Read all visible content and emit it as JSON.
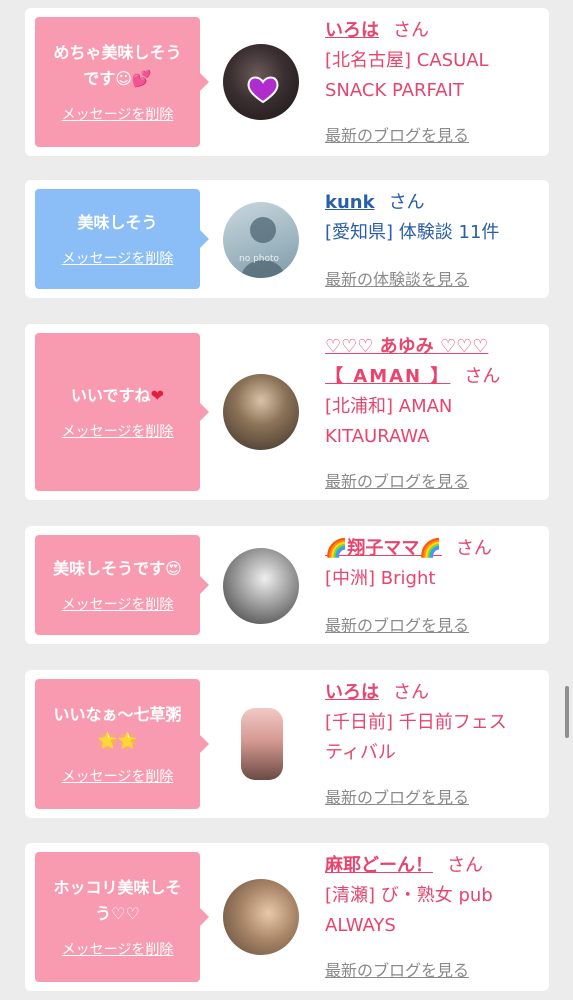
{
  "colors": {
    "background": "#ececec",
    "bubble_pink": "#f99bb0",
    "bubble_blue": "#8bbdf7",
    "name_pink": "#e8456e",
    "name_blue": "#2a5ea8",
    "link_gray": "#8a8a8a"
  },
  "san_label": "さん",
  "delete_label": "メッセージを削除",
  "messages": [
    {
      "bubble_text_1": "めちゃ美味しそう",
      "bubble_text_2": "です☺💕",
      "name": "いろは",
      "shop_1": "[北名古屋] CASUAL",
      "shop_2": "SNACK PARFAIT",
      "more_link": "最新のブログを見る"
    },
    {
      "bubble_text_1": "美味しそう",
      "name": "kunk",
      "shop_1": "[愛知県] 体験談 11件",
      "more_link": "最新の体験談を見る",
      "avatar_caption": "no photo"
    },
    {
      "bubble_text_1": "いいですね",
      "bubble_text_heart": "❤",
      "name_1": "♡♡♡ あゆみ ♡♡♡",
      "name_2": "【 AMAN 】",
      "shop_1": "[北浦和] AMAN",
      "shop_2": "KITAURAWA",
      "more_link": "最新のブログを見る"
    },
    {
      "bubble_text_1": "美味しそうです😍",
      "name": "🌈翔子ママ🌈",
      "shop_1": "[中洲] Bright",
      "more_link": "最新のブログを見る"
    },
    {
      "bubble_text_1": "いいなぁ～七草粥",
      "bubble_text_2": "🌟🌟",
      "name": "いろは",
      "shop_1": "[千日前] 千日前フェス",
      "shop_2": "ティバル",
      "more_link": "最新のブログを見る"
    },
    {
      "bubble_text_1": "ホッコリ美味しそ",
      "bubble_text_2": "う♡♡",
      "name": "麻耶どーん！",
      "shop_1": "[清瀬] び・熟女 pub",
      "shop_2": "ALWAYS",
      "more_link": "最新のブログを見る"
    }
  ]
}
